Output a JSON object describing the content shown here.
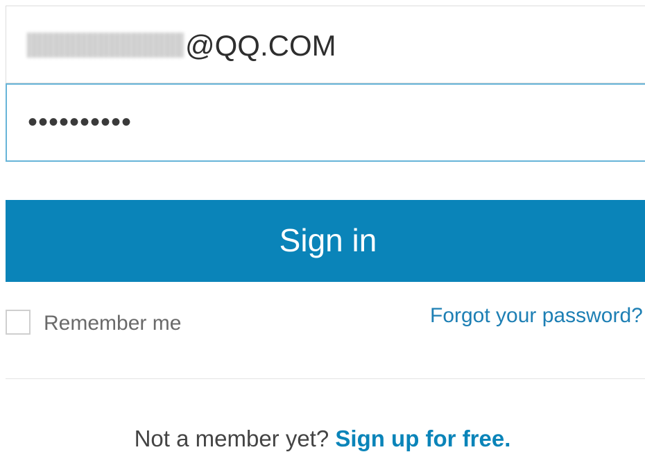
{
  "login": {
    "email_domain_value": "@QQ.COM",
    "password_mask": "••••••••••",
    "signin_label": "Sign in",
    "remember_label": "Remember me",
    "remember_checked": false,
    "forgot_label": "Forgot your password?",
    "signup_prompt": "Not a member yet?",
    "signup_link": "Sign up for free."
  },
  "colors": {
    "accent": "#0a84b9",
    "link": "#1d7fb4",
    "focus_border": "#67b4d8"
  }
}
